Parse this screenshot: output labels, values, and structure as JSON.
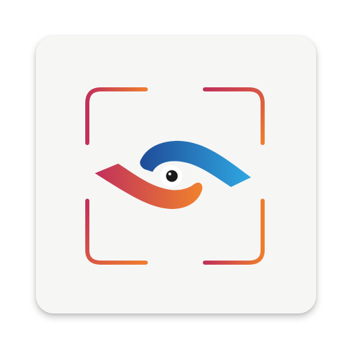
{
  "app_icon": {
    "icon": "scanner-eye-icon",
    "colors": {
      "tile_background": "#f6f6f5",
      "frame_start": "#c2305a",
      "frame_end": "#ef7d2e",
      "lower_eye_start": "#c0305c",
      "lower_eye_end": "#f0822c",
      "upper_eye_start": "#1f4b98",
      "upper_eye_end": "#2fa8e2",
      "pupil": "#1b1b1b",
      "iris_ring": "#ffffff"
    }
  }
}
